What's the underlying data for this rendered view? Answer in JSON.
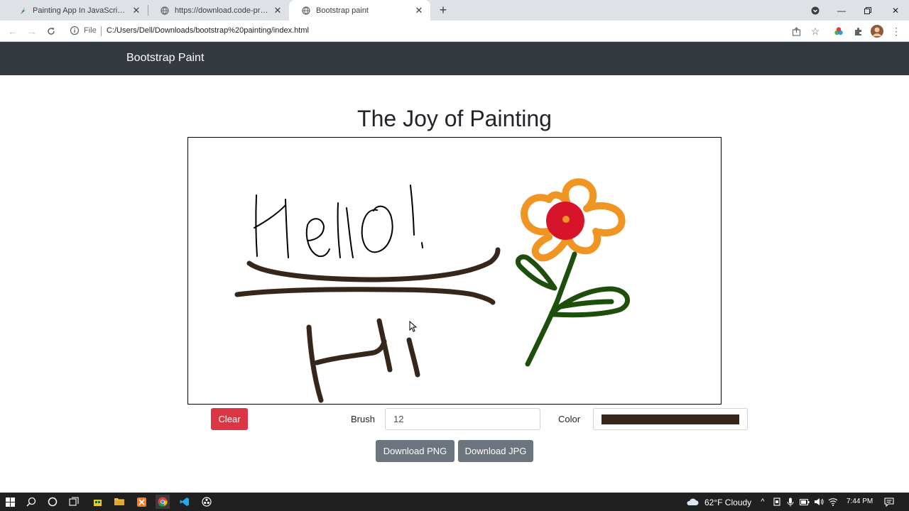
{
  "browser": {
    "tabs": [
      {
        "title": "Painting App In JavaScript With S",
        "icon": "code-projects-icon"
      },
      {
        "title": "https://download.code-projects.o",
        "icon": "globe-icon"
      },
      {
        "title": "Bootstrap paint",
        "icon": "globe-icon",
        "active": true
      }
    ],
    "address": {
      "scheme_label": "File",
      "url": "C:/Users/Dell/Downloads/bootstrap%20painting/index.html"
    }
  },
  "page": {
    "brand": "Bootstrap Paint",
    "heading": "The Joy of Painting",
    "canvas_drawing": {
      "text_strokes": [
        "Hello!",
        "Hi"
      ],
      "shapes": [
        "underline-strokes",
        "flower"
      ]
    },
    "controls": {
      "clear_label": "Clear",
      "brush_label": "Brush",
      "brush_value": "12",
      "color_label": "Color",
      "color_value": "#35281a",
      "download_png_label": "Download PNG",
      "download_jpg_label": "Download JPG"
    },
    "colors": {
      "navbar": "#343a40",
      "danger": "#dc3545",
      "secondary": "#6c757d",
      "stroke_brown": "#35281a",
      "petal_orange": "#f09423",
      "center_red": "#d7152a",
      "stem_green": "#1e4e0c"
    }
  },
  "taskbar": {
    "weather": "62°F  Cloudy",
    "time": "7:44 PM"
  }
}
